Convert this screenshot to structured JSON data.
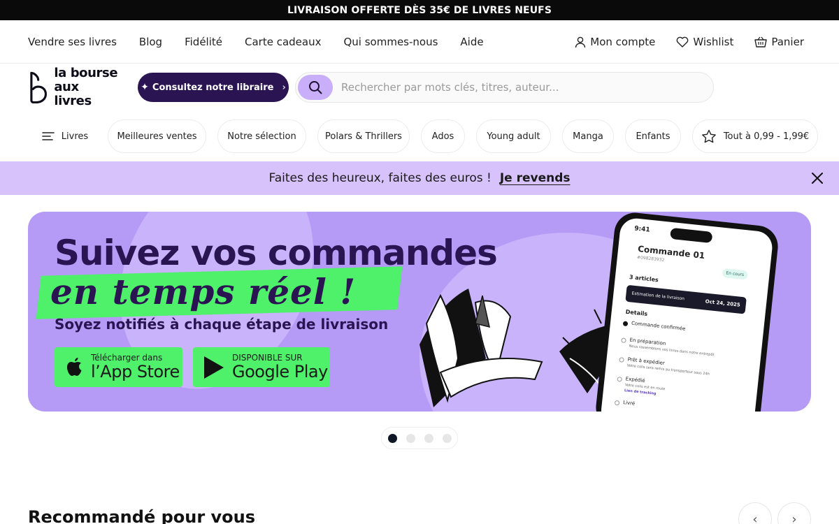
{
  "promo": {
    "text": "LIVRAISON OFFERTE DÈS 35€ DE LIVRES NEUFS"
  },
  "topnav": {
    "links": [
      "Vendre ses livres",
      "Blog",
      "Fidélité",
      "Carte cadeaux",
      "Qui sommes-nous",
      "Aide"
    ],
    "account": "Mon compte",
    "wishlist": "Wishlist",
    "cart": "Panier"
  },
  "brand": {
    "line1": "la bourse",
    "line2": "aux livres",
    "color": "#2a1552"
  },
  "libraire": {
    "label": "Consultez notre libraire"
  },
  "search": {
    "placeholder": "Rechercher par mots clés, titres, auteur..."
  },
  "categories": [
    "Livres",
    "Meilleures ventes",
    "Notre sélection",
    "Polars & Thrillers",
    "Ados",
    "Young adult",
    "Manga",
    "Enfants",
    "Tout à 0,99 - 1,99€"
  ],
  "banner": {
    "text": "Faites des heureux, faites des euros !",
    "cta": "Je revends",
    "bg": "#d8c2fb"
  },
  "hero": {
    "title": "Suivez vos commandes",
    "script": "en temps réel !",
    "subtitle": "Soyez notifiés à chaque étape de livraison",
    "appstore": {
      "small": "Télécharger dans",
      "big": "l’App Store"
    },
    "googleplay": {
      "small": "DISPONIBLE SUR",
      "big": "Google Play"
    },
    "accent": "#4ff06a",
    "bg": "#b59af6",
    "phone": {
      "time": "9:41",
      "title": "Commande 01",
      "order_no": "#098283932",
      "status": "En cours",
      "articles": "3 articles",
      "estimate_label": "Estimation de la livraison",
      "estimate_date": "Oct 24, 2025",
      "details": "Details",
      "steps": [
        {
          "title": "Commande confirmée",
          "desc": ""
        },
        {
          "title": "En préparation",
          "desc": "Nous rassemblons vos livres dans notre entrepôt"
        },
        {
          "title": "Prêt à expédier",
          "desc": "Votre colis sera remis au transporteur sous 24h"
        },
        {
          "title": "Expédié",
          "desc": "Votre colis est en route"
        },
        {
          "title": "Livré",
          "desc": ""
        }
      ],
      "tracking_link": "Lien de tracking"
    }
  },
  "carousel": {
    "count": 4,
    "active": 1
  },
  "reco": {
    "title": "Recommandé pour vous"
  }
}
